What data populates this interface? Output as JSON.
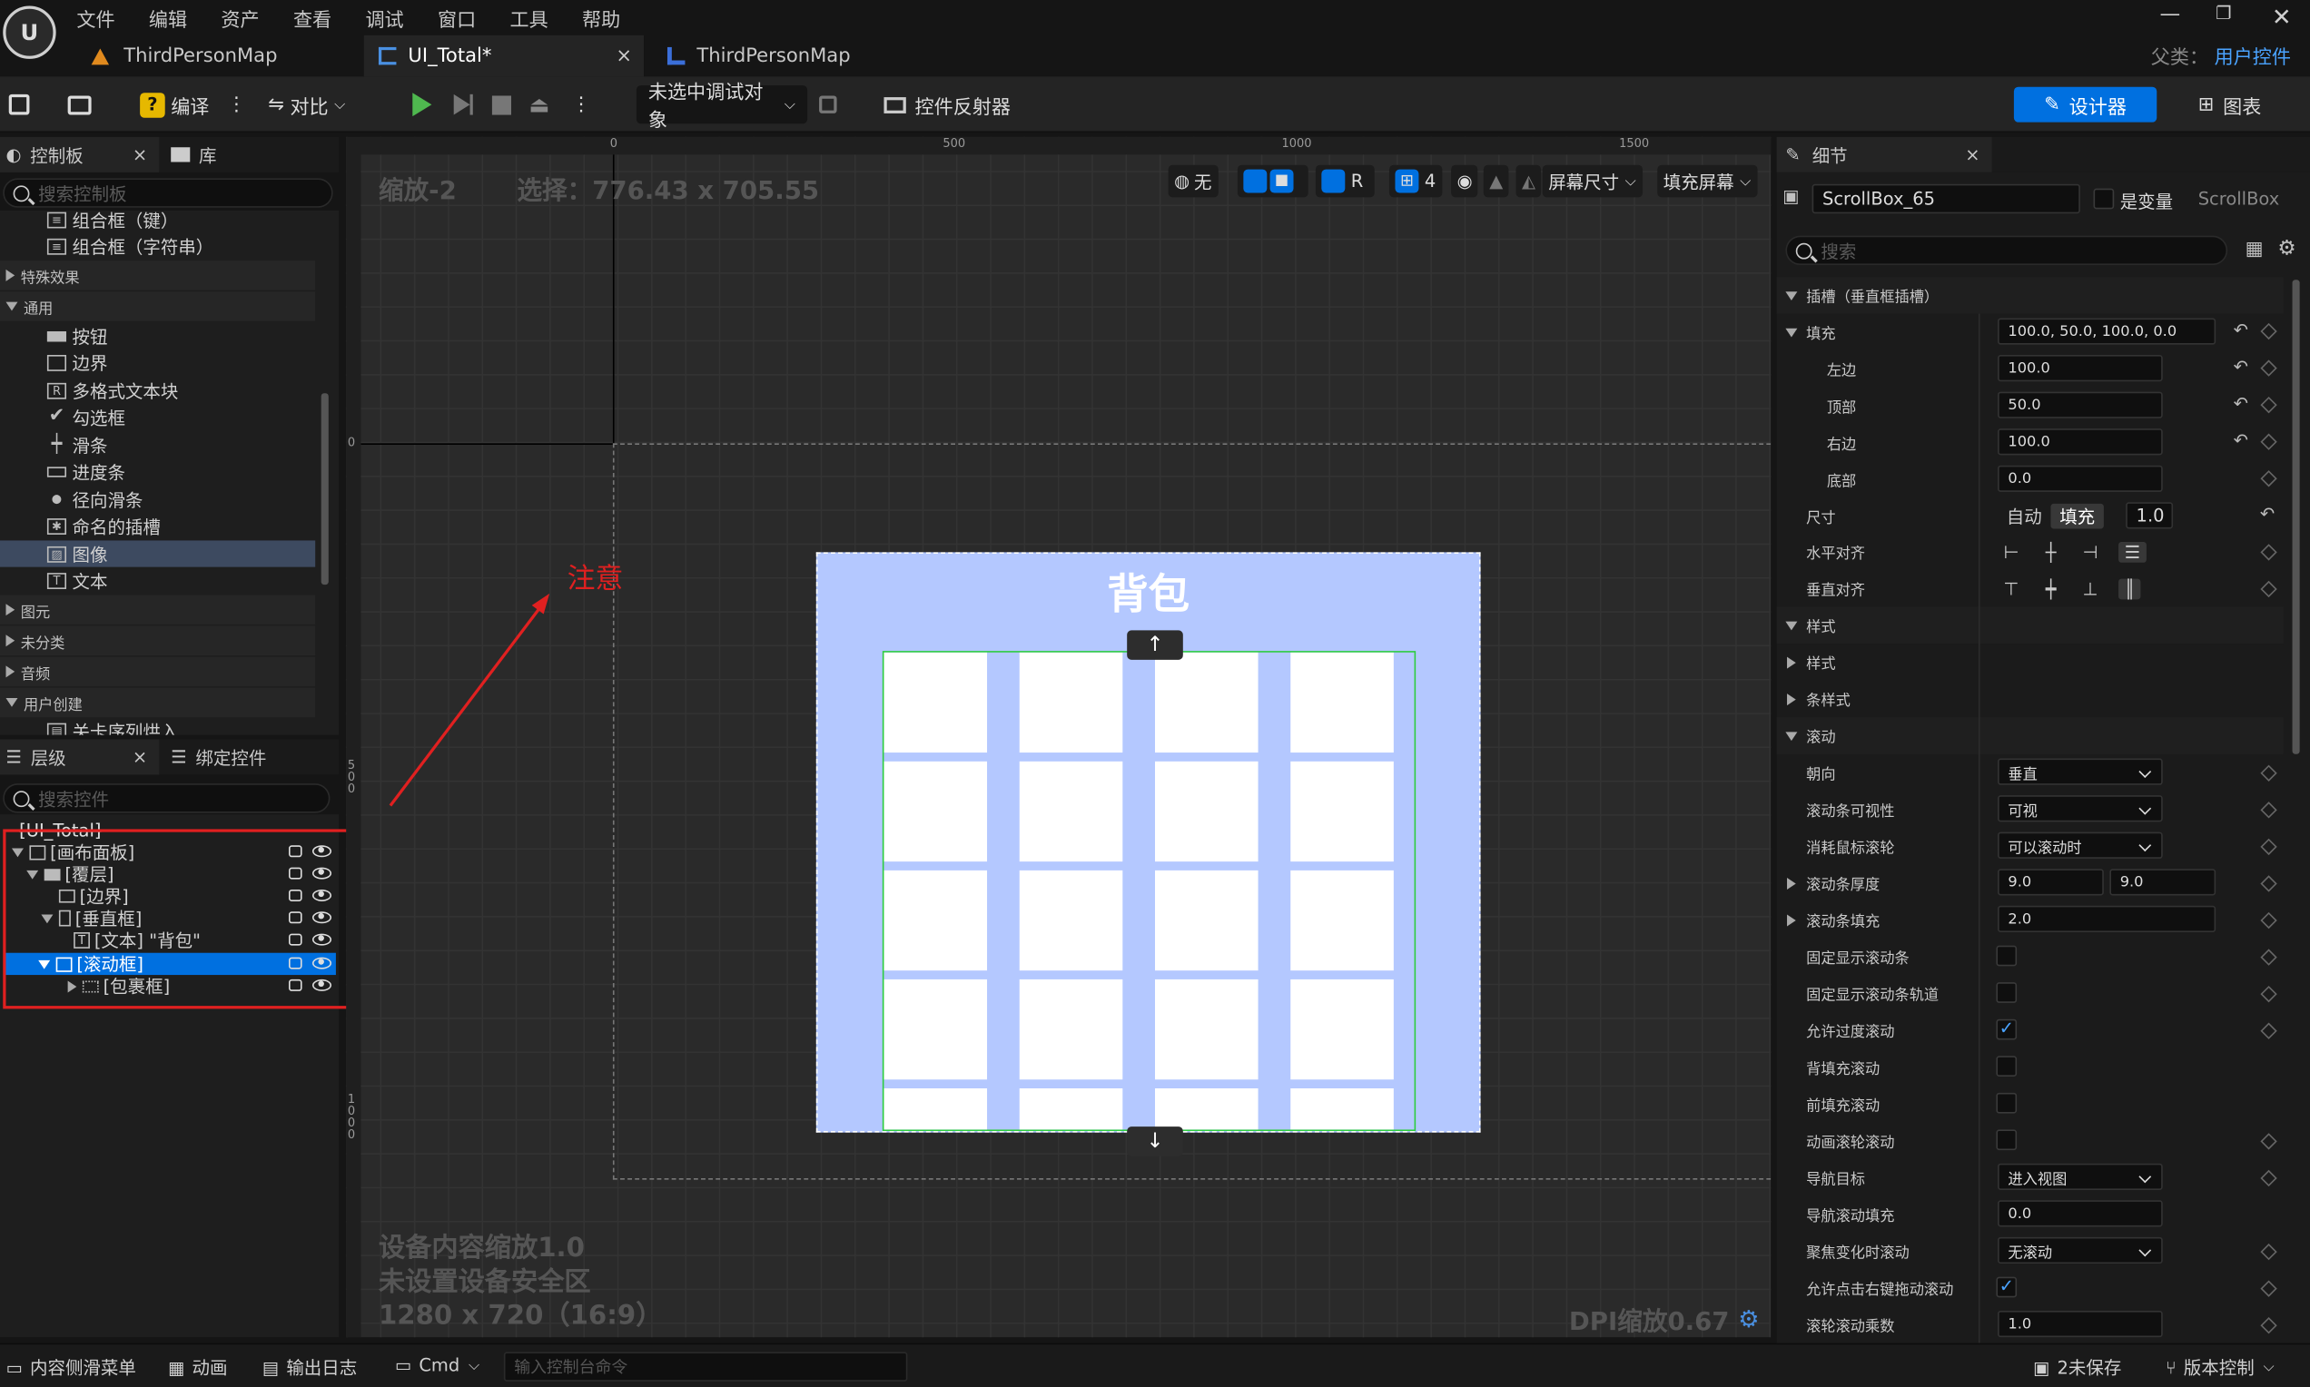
{
  "menu": [
    "文件",
    "编辑",
    "资产",
    "查看",
    "调试",
    "窗口",
    "工具",
    "帮助"
  ],
  "tabs": [
    {
      "label": "ThirdPersonMap"
    },
    {
      "label": "UI_Total*"
    },
    {
      "label": "ThirdPersonMap"
    }
  ],
  "parent": {
    "label": "父类：",
    "value": "用户控件"
  },
  "toolbar": {
    "compile": "编译",
    "diff": "对比",
    "debug_target": "未选中调试对象",
    "widget_reflector": "控件反射器",
    "designer": "设计器",
    "graph": "图表"
  },
  "palette": {
    "tab": "控制板",
    "library_tab": "库",
    "search_placeholder": "搜索控制板",
    "items_top": [
      "组合框（键）",
      "组合框（字符串）"
    ],
    "cat_effects": "特殊效果",
    "cat_common": "通用",
    "items_common": [
      "按钮",
      "边界",
      "多格式文本块",
      "勾选框",
      "滑条",
      "进度条",
      "径向滑条",
      "命名的插槽",
      "图像",
      "文本"
    ],
    "cat_primitive": "图元",
    "cat_uncategorized": "未分类",
    "cat_audio": "音频",
    "cat_user": "用户创建",
    "item_user": "关卡序列烘入"
  },
  "hierarchy": {
    "tab": "层级",
    "bind_tab": "绑定控件",
    "search_placeholder": "搜索控件",
    "root": "[UI_Total]",
    "nodes": [
      "[画布面板]",
      "[覆层]",
      "[边界]",
      "[垂直框]",
      "[文本] \"背包\"",
      "[滚动框]",
      "[包裹框]"
    ]
  },
  "viewport": {
    "zoom": "缩放-2",
    "selection": "选择：776.43 x 705.55",
    "ruler_h": [
      "0",
      "500",
      "1000",
      "1500"
    ],
    "ruler_v": [
      "0",
      "500",
      "1000"
    ],
    "btn_none": "无",
    "btn_r": "R",
    "btn_4": "4",
    "screen_size": "屏幕尺寸",
    "fill_screen": "填充屏幕",
    "annotation": "注意",
    "widget_title": "背包",
    "scroll_up": "↑",
    "scroll_down": "↓",
    "device_info": [
      "设备内容缩放1.0",
      "未设置设备安全区",
      "1280 x 720（16:9）"
    ],
    "dpi": "DPI缩放0.67"
  },
  "details": {
    "tab": "细节",
    "name": "ScrollBox_65",
    "is_variable": "是变量",
    "class": "ScrollBox",
    "search_placeholder": "搜索",
    "slot_section": "插槽（垂直框插槽）",
    "padding_label": "填充",
    "padding_value": "100.0, 50.0, 100.0, 0.0",
    "left_label": "左边",
    "left_value": "100.0",
    "top_label": "顶部",
    "top_value": "50.0",
    "right_label": "右边",
    "right_value": "100.0",
    "bottom_label": "底部",
    "bottom_value": "0.0",
    "size_label": "尺寸",
    "size_auto": "自动",
    "size_fill": "填充",
    "size_value": "1.0",
    "halign_label": "水平对齐",
    "valign_label": "垂直对齐",
    "style_section": "样式",
    "style_label": "样式",
    "bar_style_label": "条样式",
    "scroll_section": "滚动",
    "orientation_label": "朝向",
    "orientation_value": "垂直",
    "bar_visibility_label": "滚动条可视性",
    "bar_visibility_value": "可视",
    "consume_wheel_label": "消耗鼠标滚轮",
    "consume_wheel_value": "可以滚动时",
    "bar_thickness_label": "滚动条厚度",
    "bar_thickness_x": "9.0",
    "bar_thickness_y": "9.0",
    "bar_padding_label": "滚动条填充",
    "bar_padding_value": "2.0",
    "always_show_bar_label": "固定显示滚动条",
    "always_show_track_label": "固定显示滚动条轨道",
    "allow_overscroll_label": "允许过度滚动",
    "back_pad_label": "背填充滚动",
    "front_pad_label": "前填充滚动",
    "animate_wheel_label": "动画滚轮滚动",
    "nav_dest_label": "导航目标",
    "nav_dest_value": "进入视图",
    "nav_padding_label": "导航滚动填充",
    "nav_padding_value": "0.0",
    "focus_scroll_label": "聚焦变化时滚动",
    "focus_scroll_value": "无滚动",
    "right_click_drag_label": "允许点击右键拖动滚动",
    "wheel_multiplier_label": "滚轮滚动乘数",
    "wheel_multiplier_value": "1.0"
  },
  "statusbar": {
    "content_drawer": "内容侧滑菜单",
    "animation": "动画",
    "output_log": "输出日志",
    "cmd": "Cmd",
    "console_placeholder": "输入控制台命令",
    "unsaved": "2未保存",
    "source_control": "版本控制"
  },
  "colors": {
    "accent": "#0070e0",
    "widget_bg": "#b4c8ff",
    "annotation": "#e02020",
    "selection_green": "#2ecc40"
  }
}
